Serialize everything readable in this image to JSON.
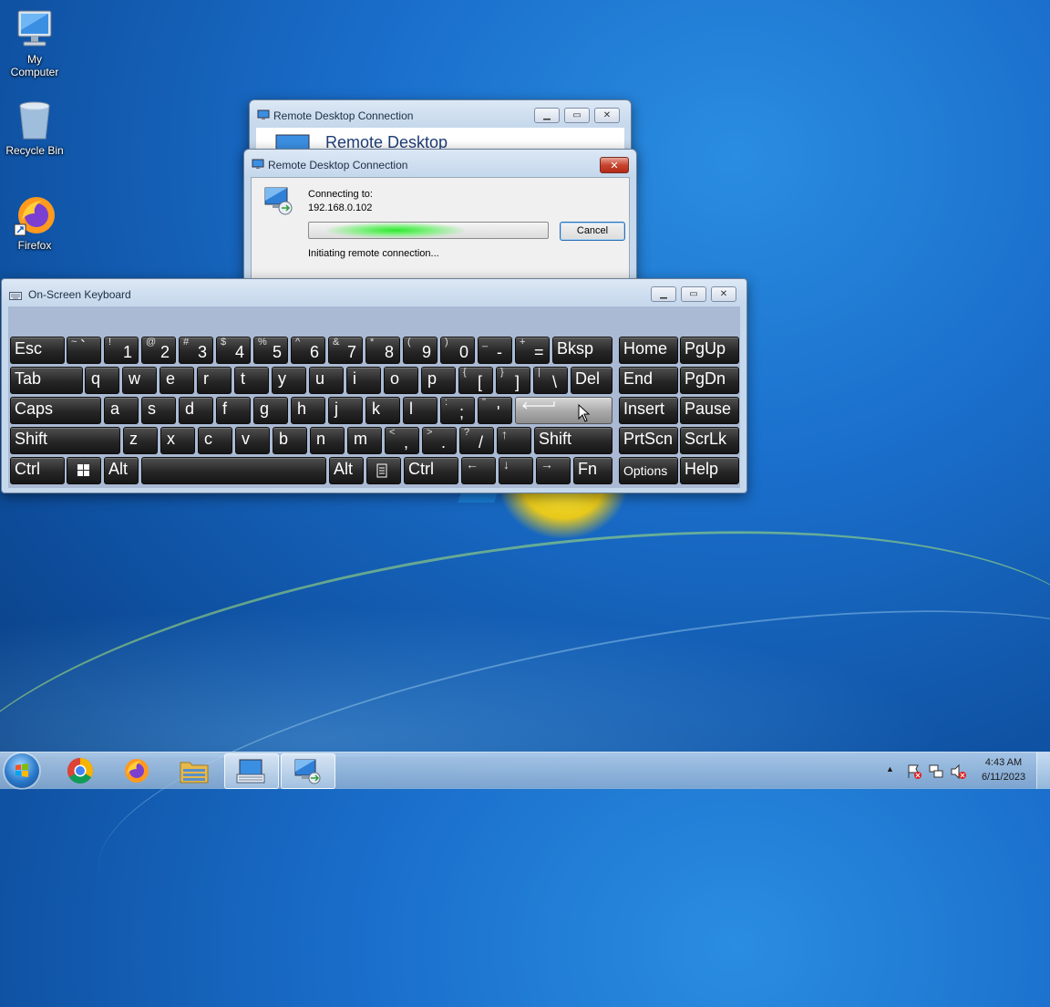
{
  "desktop": {
    "icons": [
      {
        "label": "My\nComputer",
        "line1": "My",
        "line2": "Computer",
        "icon": "computer-icon"
      },
      {
        "label": "Recycle Bin",
        "icon": "recycle-bin-icon"
      },
      {
        "label": "Firefox",
        "icon": "firefox-icon"
      }
    ]
  },
  "rdc_back": {
    "title": "Remote Desktop Connection",
    "header": "Remote Desktop"
  },
  "rdc_dialog": {
    "title": "Remote Desktop Connection",
    "connecting_label": "Connecting to:",
    "address": "192.168.0.102",
    "status": "Initiating remote connection...",
    "cancel_label": "Cancel"
  },
  "osk": {
    "title": "On-Screen Keyboard",
    "keys": {
      "esc": "Esc",
      "tilde_top": "~",
      "tilde_bot": "`",
      "n1_top": "!",
      "n1": "1",
      "n2_top": "@",
      "n2": "2",
      "n3_top": "#",
      "n3": "3",
      "n4_top": "$",
      "n4": "4",
      "n5_top": "%",
      "n5": "5",
      "n6_top": "^",
      "n6": "6",
      "n7_top": "&",
      "n7": "7",
      "n8_top": "*",
      "n8": "8",
      "n9_top": "(",
      "n9": "9",
      "n0_top": ")",
      "n0": "0",
      "minus_top": "_",
      "minus": "-",
      "eq_top": "+",
      "eq": "=",
      "bksp": "Bksp",
      "home": "Home",
      "pgup": "PgUp",
      "tab": "Tab",
      "q": "q",
      "w": "w",
      "e": "e",
      "r": "r",
      "t": "t",
      "y": "y",
      "u": "u",
      "i": "i",
      "o": "o",
      "p": "p",
      "lbr_top": "{",
      "lbr": "[",
      "rbr_top": "}",
      "rbr": "]",
      "bsl_top": "|",
      "bsl": "\\",
      "del": "Del",
      "end": "End",
      "pgdn": "PgDn",
      "caps": "Caps",
      "a": "a",
      "s": "s",
      "d": "d",
      "f": "f",
      "g": "g",
      "h": "h",
      "j": "j",
      "k": "k",
      "l": "l",
      "semi_top": ":",
      "semi": ";",
      "quote_top": "\"",
      "quote": "'",
      "insert": "Insert",
      "pause": "Pause",
      "shift": "Shift",
      "z": "z",
      "x": "x",
      "c": "c",
      "v": "v",
      "b": "b",
      "n": "n",
      "m": "m",
      "comma_top": "<",
      "comma": ",",
      "period_top": ">",
      "period": ".",
      "slash_top": "?",
      "slash": "/",
      "up": "↑",
      "shift_r": "Shift",
      "prtscn": "PrtScn",
      "scrlk": "ScrLk",
      "ctrl": "Ctrl",
      "alt": "Alt",
      "alt_r": "Alt",
      "ctrl_r": "Ctrl",
      "left": "←",
      "down": "↓",
      "right": "→",
      "fn": "Fn",
      "options": "Options",
      "help": "Help"
    }
  },
  "taskbar": {
    "time": "4:43 AM",
    "date": "6/11/2023",
    "tray_arrow": "▲"
  },
  "colors": {
    "desktop": "#1a6fcc",
    "key": "#262626",
    "progress": "#2ee82e"
  }
}
